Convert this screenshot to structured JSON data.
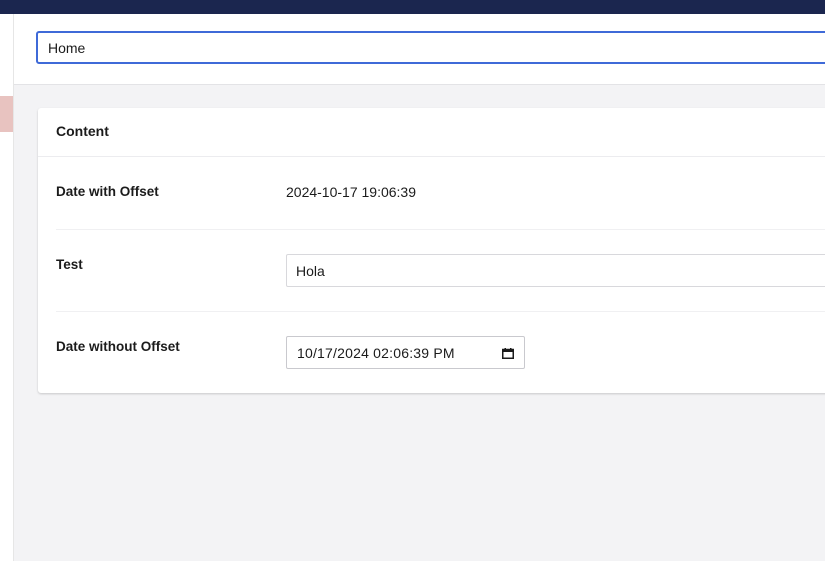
{
  "header": {
    "name_value": "Home"
  },
  "content": {
    "title": "Content",
    "fields": [
      {
        "label": "Date with Offset",
        "value": "2024-10-17 19:06:39"
      },
      {
        "label": "Test",
        "value": "Hola"
      },
      {
        "label": "Date without Offset",
        "value": "10/17/2024 02:06:39  PM"
      }
    ]
  },
  "icons": {
    "date_picker": "calendar-icon"
  },
  "colors": {
    "topbar": "#1b264f",
    "focus_border": "#3f6ad8",
    "marker": "#e8c3c0",
    "background": "#f3f3f5"
  }
}
